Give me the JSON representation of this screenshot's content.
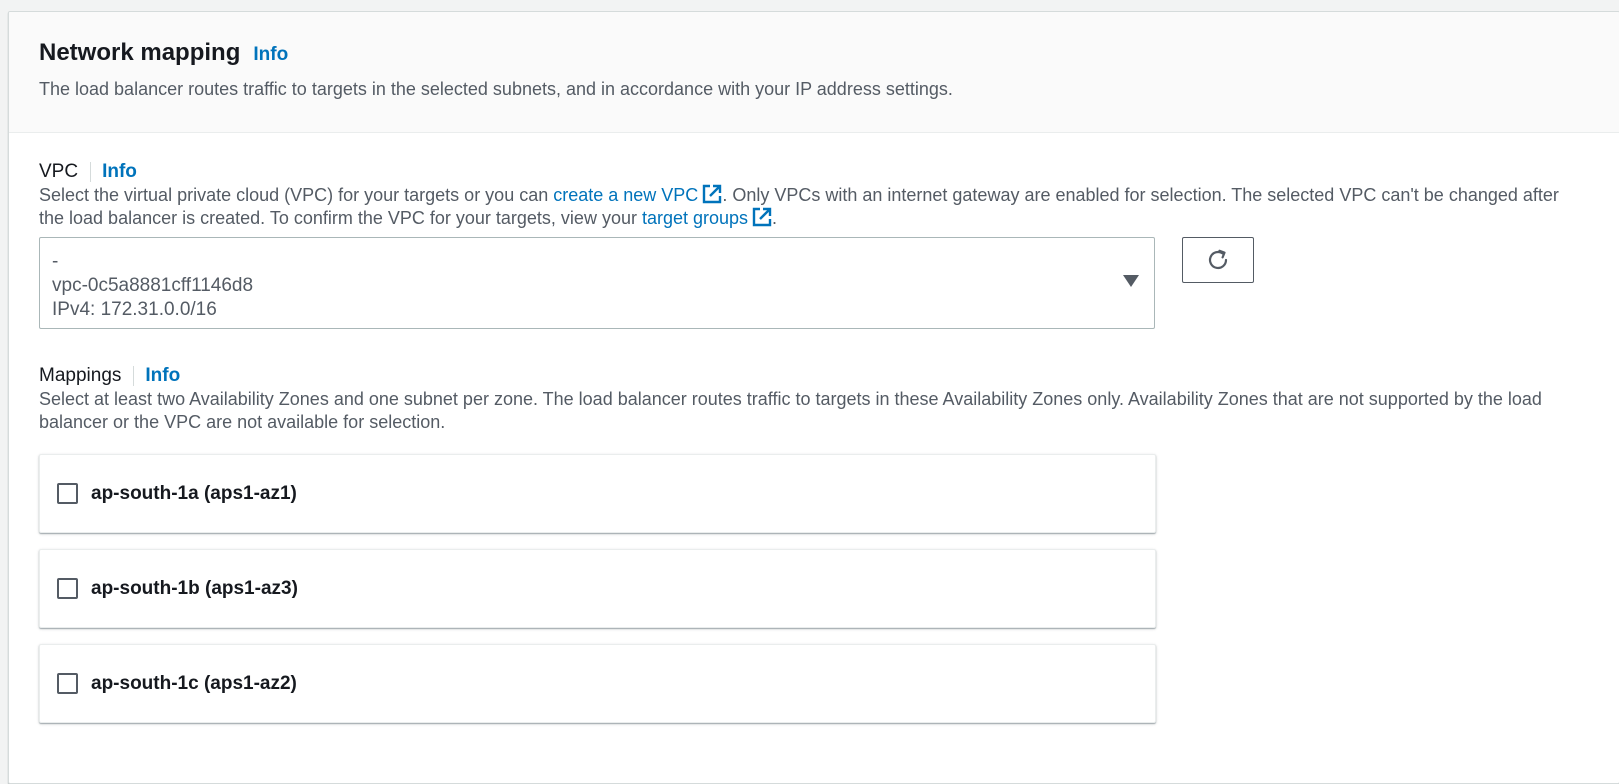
{
  "header": {
    "title": "Network mapping",
    "info": "Info",
    "description": "The load balancer routes traffic to targets in the selected subnets, and in accordance with your IP address settings."
  },
  "vpc": {
    "label": "VPC",
    "info": "Info",
    "desc_part1": "Select the virtual private cloud (VPC) for your targets or you can ",
    "create_link": "create a new VPC",
    "desc_part2": ". Only VPCs with an internet gateway are enabled for selection. The selected VPC can't be changed after the load balancer is created. To confirm the VPC for your targets, view your ",
    "target_groups_link": "target groups",
    "desc_part3": ".",
    "selected": {
      "name": "-",
      "id": "vpc-0c5a8881cff1146d8",
      "cidr": "IPv4: 172.31.0.0/16"
    },
    "refresh_icon": "refresh-icon",
    "external_icon": "external-link-icon"
  },
  "mappings": {
    "label": "Mappings",
    "info": "Info",
    "description": "Select at least two Availability Zones and one subnet per zone. The load balancer routes traffic to targets in these Availability Zones only. Availability Zones that are not supported by the load balancer or the VPC are not available for selection.",
    "zones": [
      {
        "label": "ap-south-1a (aps1-az1)",
        "checked": false
      },
      {
        "label": "ap-south-1b (aps1-az3)",
        "checked": false
      },
      {
        "label": "ap-south-1c (aps1-az2)",
        "checked": false
      }
    ]
  },
  "colors": {
    "link": "#0073bb",
    "text": "#16191f",
    "secondary_text": "#545b64",
    "border": "#aab7b8"
  }
}
